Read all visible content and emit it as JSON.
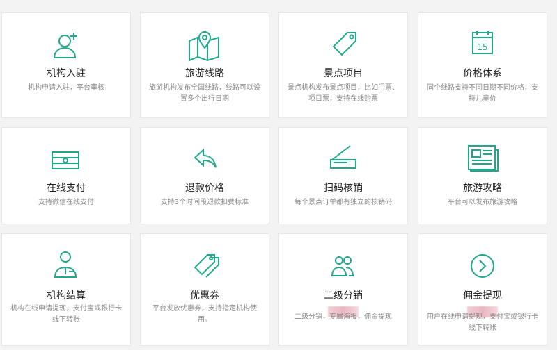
{
  "accent_color": "#1fa88a",
  "cards": [
    {
      "icon": "add-user-icon",
      "title": "机构入驻",
      "desc": "机构申请入驻，平台审核"
    },
    {
      "icon": "map-pin-icon",
      "title": "旅游线路",
      "desc": "旅游机构发布全国线路，线路可以设置多个出行日期"
    },
    {
      "icon": "tag-icon",
      "title": "景点项目",
      "desc": "景点机构发布景点项目，比如门票、项目票，支持在线购票"
    },
    {
      "icon": "calendar-icon",
      "title": "价格体系",
      "desc": "同个线路支持不同日期不同价格，支持儿童价",
      "calendar_day": "15"
    },
    {
      "icon": "cash-stack-icon",
      "title": "在线支付",
      "desc": "支持微信在线支付"
    },
    {
      "icon": "reply-arrow-icon",
      "title": "退款价格",
      "desc": "支持3个时间段退款扣费标准"
    },
    {
      "icon": "scanner-icon",
      "title": "扫码核销",
      "desc": "每个景点订单都有独立的核销码"
    },
    {
      "icon": "newspaper-icon",
      "title": "旅游攻略",
      "desc": "平台可以发布旅游攻略"
    },
    {
      "icon": "agent-icon",
      "title": "机构结算",
      "desc": "机构在线申请提现，支付宝或银行卡线下转账"
    },
    {
      "icon": "coupon-tags-icon",
      "title": "优惠券",
      "desc": "平台发放优惠券，支持指定机构使用。"
    },
    {
      "icon": "users-icon",
      "title": "二级分销",
      "desc": "二级分销，专属海报，佣金提现"
    },
    {
      "icon": "chevron-circle-icon",
      "title": "佣金提现",
      "desc": "用户在线申请提现，支付宝或银行卡线下转账"
    }
  ]
}
